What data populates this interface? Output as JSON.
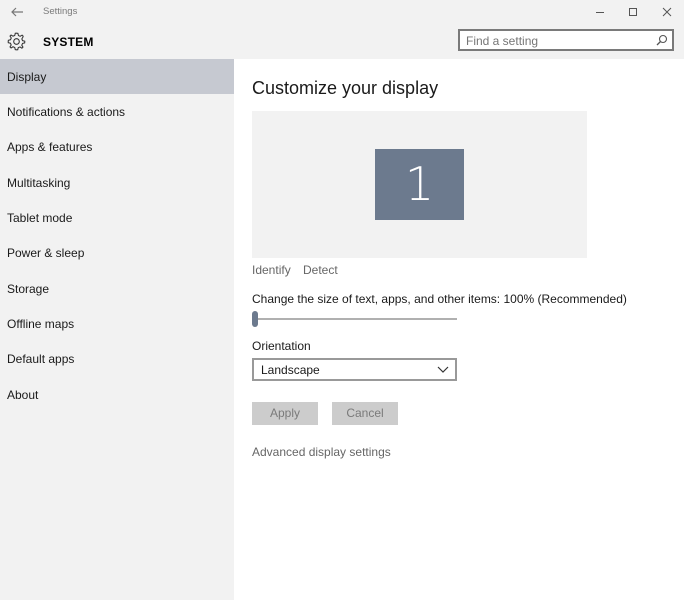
{
  "window": {
    "title": "Settings"
  },
  "header": {
    "section_title": "SYSTEM",
    "search_placeholder": "Find a setting"
  },
  "sidebar": {
    "items": [
      {
        "label": "Display",
        "active": true
      },
      {
        "label": "Notifications & actions"
      },
      {
        "label": "Apps & features"
      },
      {
        "label": "Multitasking"
      },
      {
        "label": "Tablet mode"
      },
      {
        "label": "Power & sleep"
      },
      {
        "label": "Storage"
      },
      {
        "label": "Offline maps"
      },
      {
        "label": "Default apps"
      },
      {
        "label": "About"
      }
    ]
  },
  "main": {
    "title": "Customize your display",
    "monitor_number": "1",
    "identify_label": "Identify",
    "detect_label": "Detect",
    "scale_label": "Change the size of text, apps, and other items: 100% (Recommended)",
    "scale_slider_fraction": 0.0,
    "orientation_label": "Orientation",
    "orientation_value": "Landscape",
    "apply_label": "Apply",
    "cancel_label": "Cancel",
    "advanced_link": "Advanced display settings"
  },
  "colors": {
    "selected_nav": "#c6c9d1",
    "monitor": "#6c7a8e",
    "sidebar_bg": "#f2f2f2"
  }
}
